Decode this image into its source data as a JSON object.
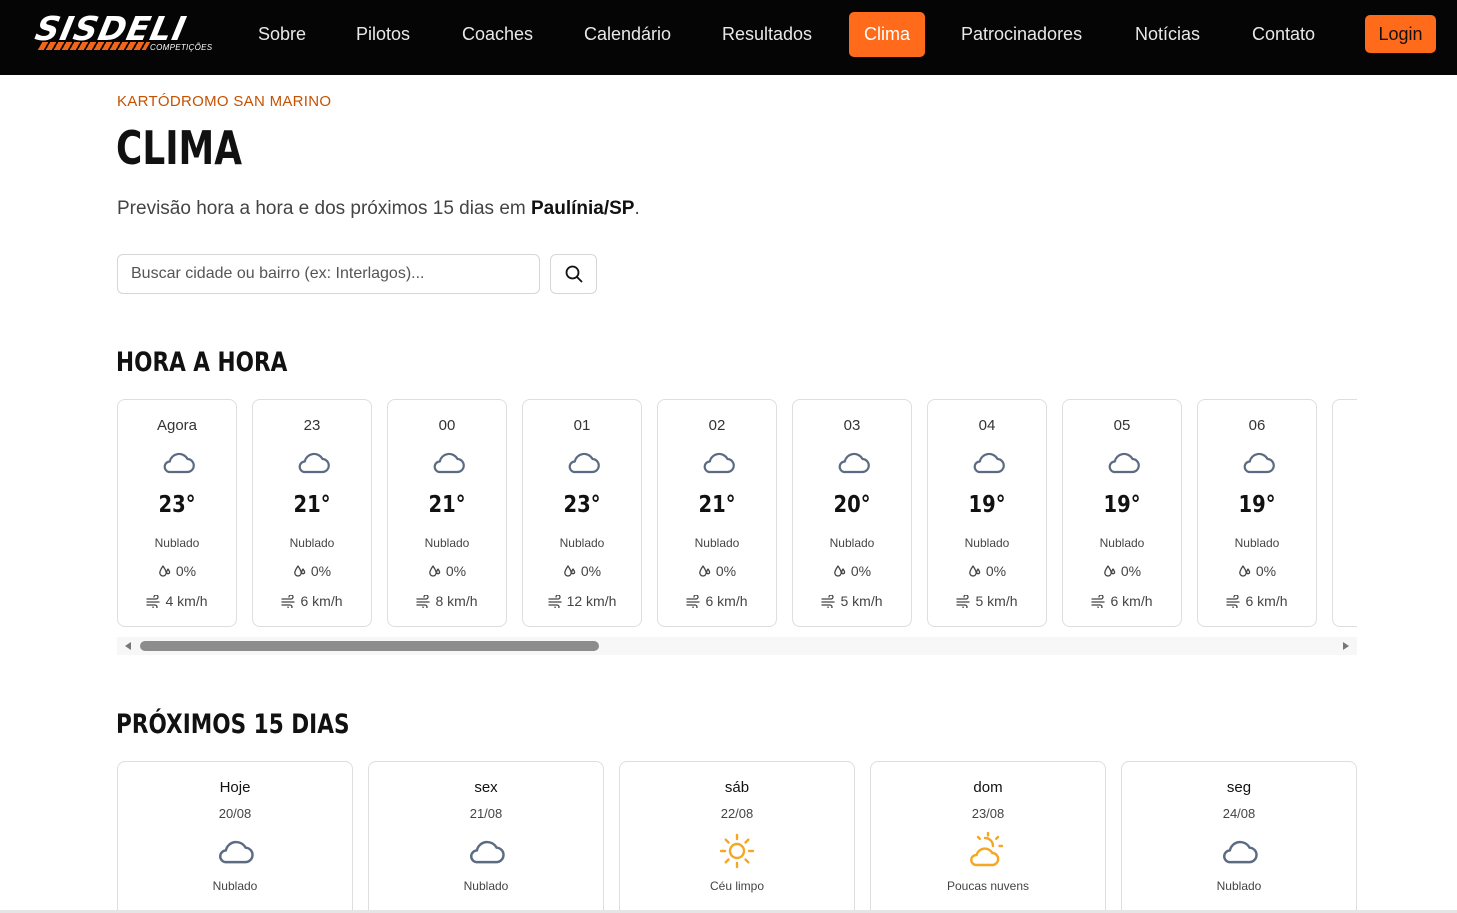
{
  "nav": {
    "logo_text": "SISDELI",
    "logo_sub": "COMPETIÇÕES",
    "items": [
      "Sobre",
      "Pilotos",
      "Coaches",
      "Calendário",
      "Resultados",
      "Clima",
      "Patrocinadores",
      "Notícias",
      "Contato"
    ],
    "active": "Clima",
    "login_label": "Login"
  },
  "header": {
    "eyebrow": "KARTÓDROMO SAN MARINO",
    "title": "CLIMA",
    "subtitle_prefix": "Previsão hora a hora e dos próximos 15 dias em ",
    "subtitle_location": "Paulínia/SP",
    "subtitle_suffix": "."
  },
  "search": {
    "placeholder": "Buscar cidade ou bairro (ex: Interlagos)...",
    "button_icon": "search-icon"
  },
  "hourly": {
    "title": "HORA A HORA",
    "items": [
      {
        "label": "Agora",
        "icon": "cloud-icon",
        "temp": "23°",
        "cond": "Nublado",
        "rain": "0%",
        "wind": "4 km/h"
      },
      {
        "label": "23",
        "icon": "cloud-icon",
        "temp": "21°",
        "cond": "Nublado",
        "rain": "0%",
        "wind": "6 km/h"
      },
      {
        "label": "00",
        "icon": "cloud-icon",
        "temp": "21°",
        "cond": "Nublado",
        "rain": "0%",
        "wind": "8 km/h"
      },
      {
        "label": "01",
        "icon": "cloud-icon",
        "temp": "23°",
        "cond": "Nublado",
        "rain": "0%",
        "wind": "12 km/h"
      },
      {
        "label": "02",
        "icon": "cloud-icon",
        "temp": "21°",
        "cond": "Nublado",
        "rain": "0%",
        "wind": "6 km/h"
      },
      {
        "label": "03",
        "icon": "cloud-icon",
        "temp": "20°",
        "cond": "Nublado",
        "rain": "0%",
        "wind": "5 km/h"
      },
      {
        "label": "04",
        "icon": "cloud-icon",
        "temp": "19°",
        "cond": "Nublado",
        "rain": "0%",
        "wind": "5 km/h"
      },
      {
        "label": "05",
        "icon": "cloud-icon",
        "temp": "19°",
        "cond": "Nublado",
        "rain": "0%",
        "wind": "6 km/h"
      },
      {
        "label": "06",
        "icon": "cloud-icon",
        "temp": "19°",
        "cond": "Nublado",
        "rain": "0%",
        "wind": "6 km/h"
      }
    ]
  },
  "daily": {
    "title": "PRÓXIMOS 15 DIAS",
    "items": [
      {
        "name": "Hoje",
        "date": "20/08",
        "icon": "cloud-icon",
        "cond": "Nublado"
      },
      {
        "name": "sex",
        "date": "21/08",
        "icon": "cloud-icon",
        "cond": "Nublado"
      },
      {
        "name": "sáb",
        "date": "22/08",
        "icon": "sun-icon",
        "cond": "Céu limpo"
      },
      {
        "name": "dom",
        "date": "23/08",
        "icon": "partly-cloudy-icon",
        "cond": "Poucas nuvens"
      },
      {
        "name": "seg",
        "date": "24/08",
        "icon": "cloud-icon",
        "cond": "Nublado"
      }
    ]
  },
  "colors": {
    "accent": "#ff6b1a",
    "eyebrow": "#c65102",
    "nav_bg": "#050505",
    "cloud_stroke": "#5b6b82",
    "sun": "#f5a623"
  }
}
